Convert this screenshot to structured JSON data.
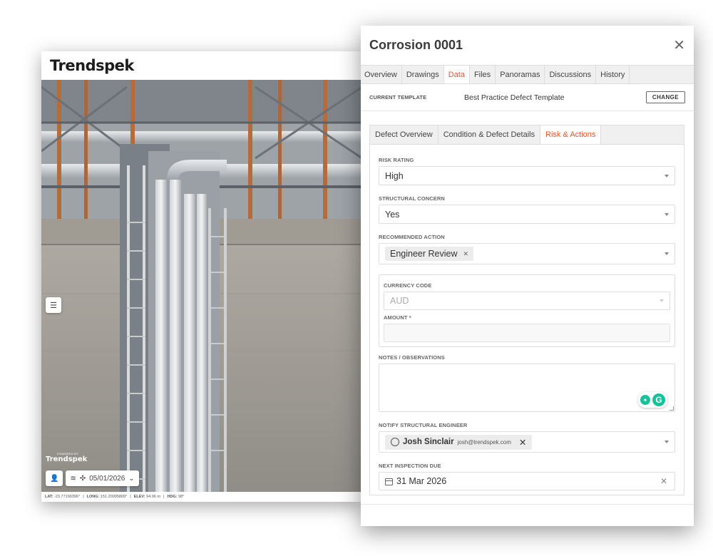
{
  "viewer": {
    "brand_prefix": "Trend",
    "brand_suffix": "spek",
    "powered_by": "POWERED BY",
    "powered_logo": "Trendspek",
    "date": "05/01/2026",
    "coords": {
      "lat_label": "LAT:",
      "lat": "-23.77190396°",
      "long_label": "LONG:",
      "long": "151.20005809°",
      "elev_label": "ELEV:",
      "elev": "94.96 m",
      "hdg_label": "HDG:",
      "hdg": "98°"
    }
  },
  "panel": {
    "title": "Corrosion 0001",
    "tabs": [
      "Overview",
      "Drawings",
      "Data",
      "Files",
      "Panoramas",
      "Discussions",
      "History"
    ],
    "active_tab": "Data",
    "template_label": "CURRENT TEMPLATE",
    "template_value": "Best Practice Defect Template",
    "change_label": "CHANGE",
    "subtabs": [
      "Defect Overview",
      "Condition & Defect Details",
      "Risk & Actions"
    ],
    "active_subtab": "Risk & Actions",
    "fields": {
      "risk_rating_label": "RISK RATING",
      "risk_rating_value": "High",
      "structural_label": "STRUCTURAL CONCERN",
      "structural_value": "Yes",
      "action_label": "RECOMMENDED ACTION",
      "action_chip": "Engineer Review",
      "currency_label": "CURRENCY CODE",
      "currency_value": "AUD",
      "amount_label": "AMOUNT *",
      "notes_label": "NOTES / OBSERVATIONS",
      "notify_label": "NOTIFY STRUCTURAL ENGINEER",
      "notify_name": "Josh Sinclair",
      "notify_email": "josh@trendspek.com",
      "due_label": "NEXT INSPECTION DUE",
      "due_value": "31 Mar 2026"
    }
  },
  "colors": {
    "accent": "#e2552a",
    "grammarly": "#15c39a"
  }
}
